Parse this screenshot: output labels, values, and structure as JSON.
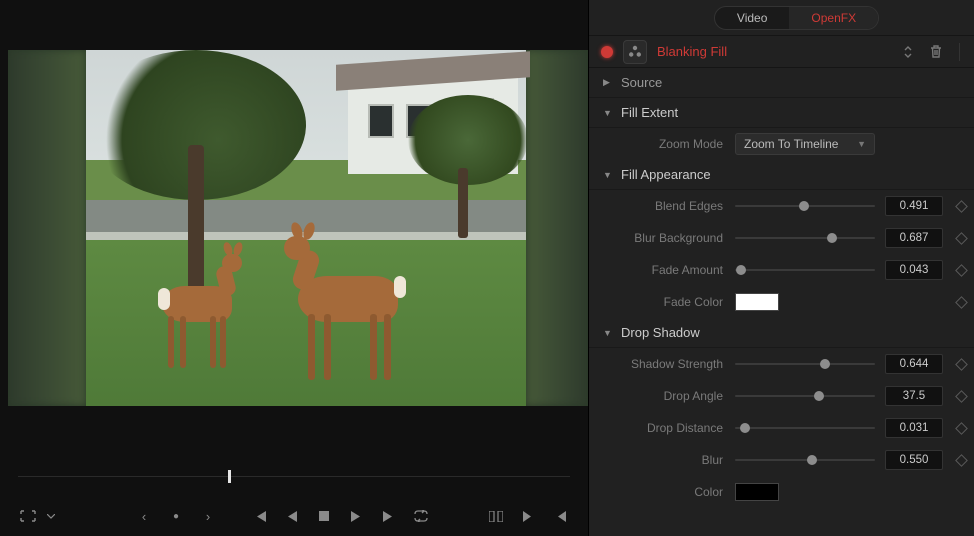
{
  "tabs": {
    "video": "Video",
    "openfx": "OpenFX"
  },
  "effect": {
    "name": "Blanking Fill"
  },
  "sections": {
    "source": "Source",
    "fill_extent": "Fill Extent",
    "fill_appearance": "Fill Appearance",
    "drop_shadow": "Drop Shadow"
  },
  "fill_extent": {
    "zoom_mode_label": "Zoom Mode",
    "zoom_mode_value": "Zoom To Timeline"
  },
  "fill_appearance": {
    "blend_edges": {
      "label": "Blend Edges",
      "value": "0.491",
      "pos": 49
    },
    "blur_background": {
      "label": "Blur Background",
      "value": "0.687",
      "pos": 69
    },
    "fade_amount": {
      "label": "Fade Amount",
      "value": "0.043",
      "pos": 4
    },
    "fade_color": {
      "label": "Fade Color",
      "color": "#ffffff"
    }
  },
  "drop_shadow": {
    "shadow_strength": {
      "label": "Shadow Strength",
      "value": "0.644",
      "pos": 64
    },
    "drop_angle": {
      "label": "Drop Angle",
      "value": "37.5",
      "pos": 60
    },
    "drop_distance": {
      "label": "Drop Distance",
      "value": "0.031",
      "pos": 7
    },
    "blur": {
      "label": "Blur",
      "value": "0.550",
      "pos": 55
    },
    "color": {
      "label": "Color",
      "color": "#000000"
    }
  }
}
